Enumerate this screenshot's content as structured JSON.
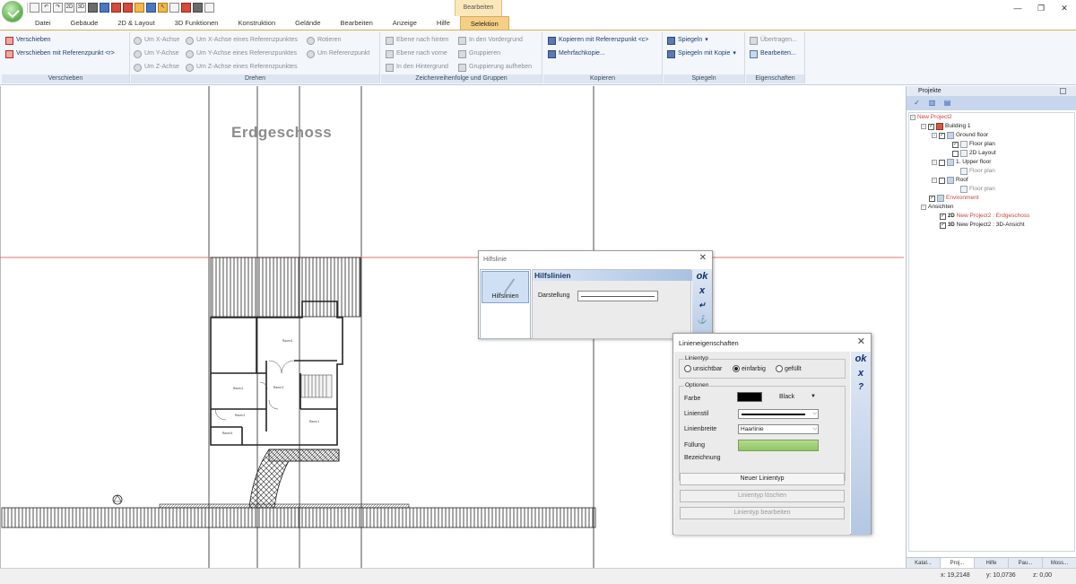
{
  "titlebar": {
    "context_group": "Bearbeiten",
    "minimize": "—",
    "restore": "❐",
    "close": "✕"
  },
  "quick_access": {
    "icons": [
      "new-icon",
      "undo-icon",
      "redo-icon",
      "2d-icon",
      "3d-icon",
      "wall-icon",
      "table-icon",
      "color-icon",
      "magnet-icon",
      "select-icon",
      "measure-icon",
      "pointer-icon",
      "print-icon",
      "help-icon",
      "paint-icon",
      "copy-icon"
    ],
    "labels": [
      "",
      "↶",
      "↷",
      "2D",
      "3D",
      "",
      "",
      "",
      "",
      "",
      "",
      "↖",
      "",
      "",
      "",
      ""
    ]
  },
  "tabs": [
    "Datei",
    "Gebäude",
    "2D & Layout",
    "3D Funktionen",
    "Konstruktion",
    "Gelände",
    "Bearbeiten",
    "Anzeige",
    "Hilfe",
    "Selektion"
  ],
  "ribbon": {
    "verschieben": {
      "caption": "Verschieben",
      "move": "Verschieben",
      "move_ref": "Verschieben mit Referenzpunkt <r>"
    },
    "drehen": {
      "caption": "Drehen",
      "x_axis": "Um X-Achse",
      "y_axis": "Um Y-Achse",
      "z_axis": "Um Z-Achse",
      "x_axis_ref": "Um X-Achse eines Referenzpunktes",
      "y_axis_ref": "Um Y-Achse eines Referenzpunktes",
      "z_axis_ref": "Um Z-Achse eines Referenzpunktes",
      "rotate": "Rotieren",
      "ref_point": "Um Referenzpunkt"
    },
    "order": {
      "caption": "Zeichenreihenfolge und Gruppen",
      "back_one": "Ebene nach hinten",
      "forward_one": "Ebene nach vorne",
      "to_back": "In den Hintergrund",
      "to_front": "In den Vordergrund",
      "group": "Gruppieren",
      "ungroup": "Gruppierung aufheben"
    },
    "kopieren": {
      "caption": "Kopieren",
      "copy_ref": "Kopieren mit Referenzpunkt <c>",
      "multi_copy": "Mehrfachkopie..."
    },
    "spiegeln": {
      "caption": "Spiegeln",
      "mirror": "Spiegeln",
      "mirror_copy": "Spiegeln mit Kopie"
    },
    "eigenschaften": {
      "caption": "Eigenschaften",
      "transfer": "Übertragen...",
      "edit": "Bearbeiten..."
    }
  },
  "canvas": {
    "floor_label": "Erdgeschoss",
    "room_labels": [
      "Raum 6",
      "Raum 4",
      "Raum 3",
      "Raum 1",
      "Raum 2",
      "Raum 5"
    ]
  },
  "projects_panel": {
    "title": "Projekte",
    "tree": [
      {
        "label": "New Project2",
        "color": "red"
      },
      {
        "label": "Building 1"
      },
      {
        "label": "Ground floor"
      },
      {
        "label": "Floor plan"
      },
      {
        "label": "2D Layout"
      },
      {
        "label": "1. Upper floor"
      },
      {
        "label": "Floor plan",
        "color": "grey"
      },
      {
        "label": "Roof"
      },
      {
        "label": "Floor plan",
        "color": "grey"
      },
      {
        "label": "Environment",
        "color": "red"
      },
      {
        "label": "Ansichten"
      },
      {
        "label": "New Project2 : Erdgeschoss",
        "tag": "2D",
        "color": "red"
      },
      {
        "label": "New Project2 : 3D-Ansicht",
        "tag": "3D"
      }
    ],
    "bottom_tabs": [
      "Katal...",
      "Proj...",
      "Hilfe",
      "Pau...",
      "Moss..."
    ]
  },
  "statusbar": {
    "x": "x: 19,2148",
    "y": "y: 10,0736",
    "z": "z: 0,00"
  },
  "dialog_hilfslinie": {
    "title": "Hilfslinie",
    "side_item": "Hilfslinien",
    "header": "Hilfslinien",
    "darstellung_label": "Darstellung",
    "btn_ok": "ok",
    "btn_x": "x",
    "btn_enter": "↵",
    "btn_anchor": "⚓"
  },
  "dialog_linien": {
    "title": "Linieneigenschaften",
    "linientyp_legend": "Linientyp",
    "radio_invisible": "unsichtbar",
    "radio_solid": "einfarbig",
    "radio_filled": "gefüllt",
    "optionen_legend": "Optionen",
    "farbe_label": "Farbe",
    "farbe_value": "Black",
    "farbe_hex": "#000000",
    "linienstil_label": "Linienstil",
    "linienbreite_label": "Linienbreite",
    "linienbreite_value": "Haarlinie",
    "fuellung_label": "Füllung",
    "fuellung_color": "#9fd074",
    "bezeichnung_label": "Bezeichnung",
    "btn_new": "Neuer Linientyp",
    "btn_delete": "Linientyp löschen",
    "btn_edit": "Linientyp bearbeiten",
    "btn_ok": "ok",
    "btn_x": "x",
    "btn_help": "?"
  }
}
